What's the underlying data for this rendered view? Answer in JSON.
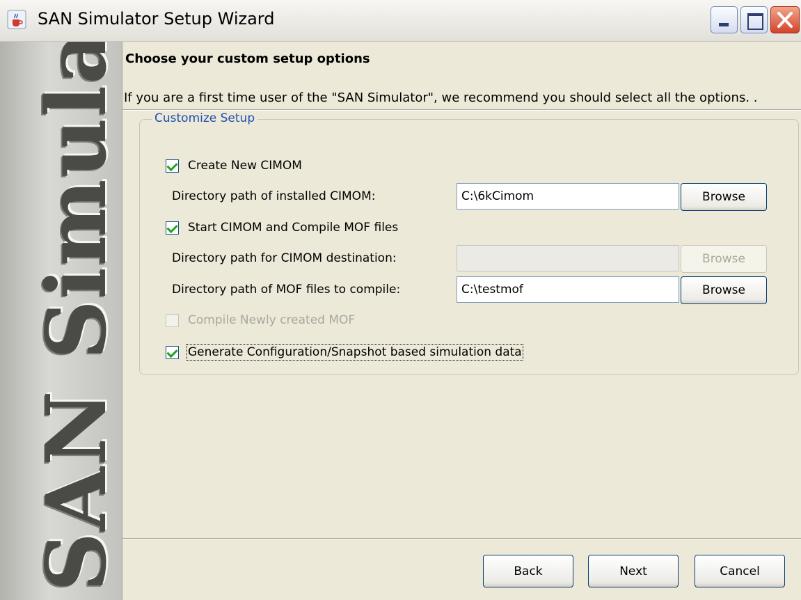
{
  "window": {
    "title": "SAN Simulator Setup Wizard",
    "icon": "java-cup-icon"
  },
  "banner": {
    "text": "SAN Simulator"
  },
  "header": {
    "title": "Choose your custom setup options",
    "description": "If you are a first time user of the \"SAN Simulator\", we recommend you should select all the options. ."
  },
  "group": {
    "title": "Customize Setup",
    "create_cimom": {
      "label": "Create New CIMOM",
      "checked": true
    },
    "installed_cimom": {
      "label": "Directory path of installed CIMOM:",
      "value": "C:\\6kCimom",
      "button": "Browse"
    },
    "start_cimom": {
      "label": "Start CIMOM and Compile MOF files",
      "checked": true
    },
    "cimom_destination": {
      "label": "Directory path for CIMOM destination:",
      "value": "",
      "button": "Browse",
      "enabled": false
    },
    "mof_files": {
      "label": "Directory path of MOF files to compile:",
      "value": "C:\\testmof",
      "button": "Browse"
    },
    "compile_new_mof": {
      "label": "Compile Newly created MOF",
      "checked": false,
      "enabled": false
    },
    "generate_config": {
      "label": "Generate Configuration/Snapshot based simulation data",
      "checked": true
    }
  },
  "footer": {
    "back": "Back",
    "next": "Next",
    "cancel": "Cancel"
  },
  "colors": {
    "group_title": "#1f4fb0",
    "checkmark": "#21a121",
    "dialog_bg": "#ece9d8"
  }
}
